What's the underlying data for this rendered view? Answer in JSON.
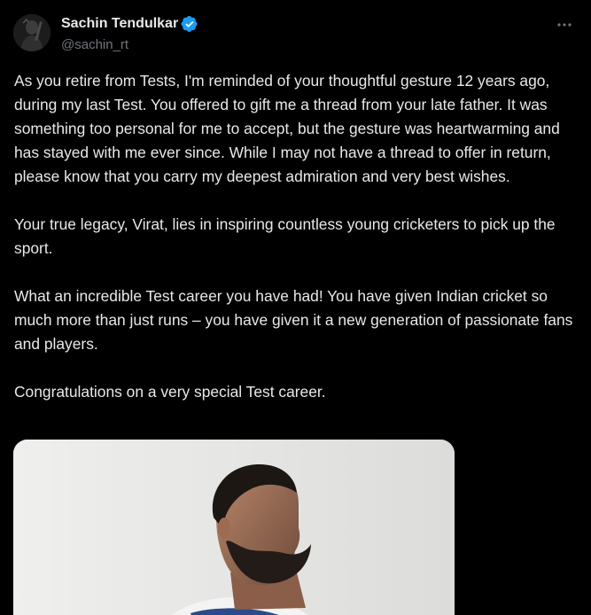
{
  "author": {
    "display_name": "Sachin Tendulkar",
    "handle": "@sachin_rt",
    "verified": true,
    "verified_icon": "verified-badge-icon",
    "avatar_icon": "profile-avatar"
  },
  "more_icon": "more-options-icon",
  "tweet": {
    "paragraphs": [
      "As you retire from Tests, I'm reminded of your thoughtful gesture 12 years ago, during my last Test. You offered to gift me a thread from your late father. It was something too personal for me to accept, but the gesture was heartwarming and has stayed with me ever since. While I may not have a thread to offer in return, please know that you carry my deepest admiration and very best wishes.",
      "Your true legacy, Virat, lies in inspiring countless young cricketers to pick up the sport.",
      "What an incredible Test career you have had! You have given Indian cricket so much more than just runs – you have given it a new generation of passionate fans and players.",
      "Congratulations on a very special Test career."
    ]
  },
  "colors": {
    "background": "#000000",
    "text": "#e7e9ea",
    "secondary_text": "#71767b",
    "verified_blue": "#1d9bf0"
  }
}
